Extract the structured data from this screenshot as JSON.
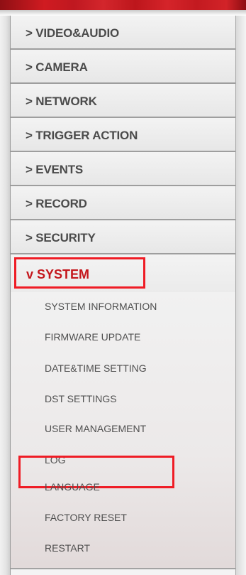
{
  "colors": {
    "accent_red": "#c4161c",
    "highlight_red": "#ef1c25",
    "text_gray": "#4b4b4b"
  },
  "menu": {
    "items": [
      {
        "label": "> VIDEO&AUDIO"
      },
      {
        "label": "> CAMERA"
      },
      {
        "label": "> NETWORK"
      },
      {
        "label": "> TRIGGER ACTION"
      },
      {
        "label": "> EVENTS"
      },
      {
        "label": "> RECORD"
      },
      {
        "label": "> SECURITY"
      }
    ],
    "active": {
      "label": "v SYSTEM",
      "subitems": [
        {
          "label": "SYSTEM INFORMATION"
        },
        {
          "label": "FIRMWARE UPDATE"
        },
        {
          "label": "DATE&TIME SETTING"
        },
        {
          "label": "DST SETTINGS"
        },
        {
          "label": "USER MANAGEMENT"
        },
        {
          "label": "LOG"
        },
        {
          "label": "LANGUAGE"
        },
        {
          "label": "FACTORY RESET"
        },
        {
          "label": "RESTART"
        }
      ]
    }
  }
}
